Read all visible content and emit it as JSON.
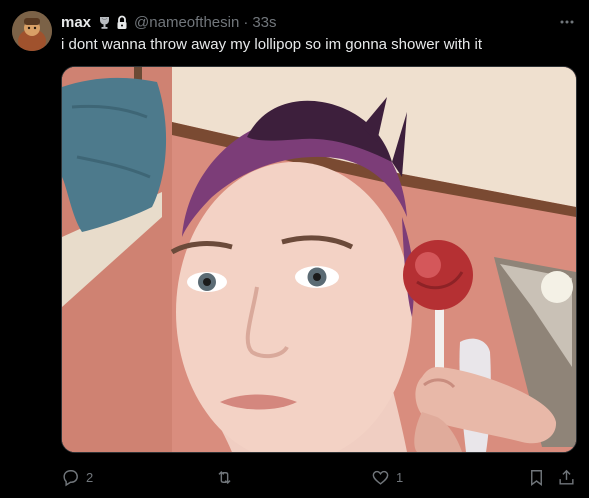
{
  "tweet": {
    "display_name": "max",
    "handle": "@nameofthesin",
    "separator": "·",
    "time": "33s",
    "text": "i dont wanna throw away my lollipop so im gonna shower with it",
    "replies": "2",
    "likes": "1"
  },
  "icons": {
    "badge": "trophy-badge-icon",
    "lock": "lock-icon",
    "more": "more-icon",
    "reply": "reply-icon",
    "retweet": "retweet-icon",
    "like": "like-icon",
    "bookmark": "bookmark-icon",
    "share": "share-icon"
  },
  "colors": {
    "background": "#000000",
    "text": "#e7e9ea",
    "muted": "#71767b",
    "border": "#2f3336"
  }
}
